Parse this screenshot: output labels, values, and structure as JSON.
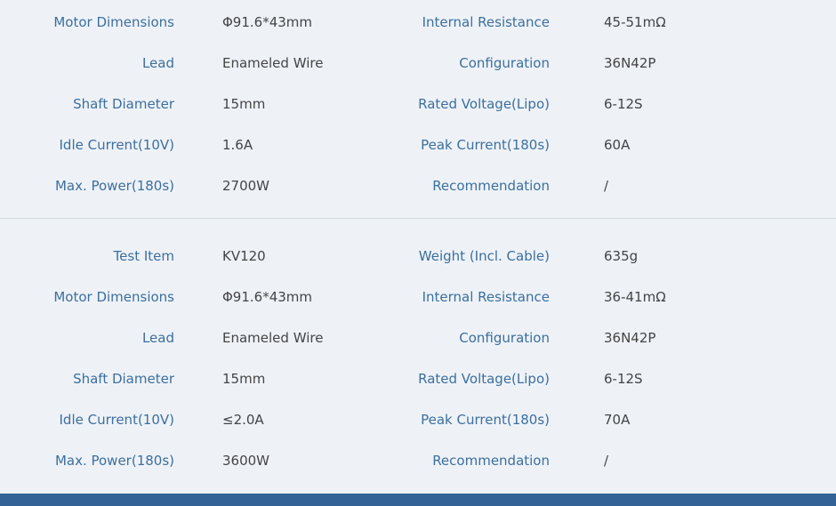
{
  "sections": [
    {
      "rows": [
        {
          "l1": "Motor Dimensions",
          "v1": "Φ91.6*43mm",
          "l2": "Internal Resistance",
          "v2": "45-51mΩ"
        },
        {
          "l1": "Lead",
          "v1": "Enameled Wire",
          "l2": "Configuration",
          "v2": "36N42P"
        },
        {
          "l1": "Shaft Diameter",
          "v1": "15mm",
          "l2": "Rated Voltage(Lipo)",
          "v2": "6-12S"
        },
        {
          "l1": "Idle Current(10V)",
          "v1": "1.6A",
          "l2": "Peak Current(180s)",
          "v2": "60A"
        },
        {
          "l1": "Max. Power(180s)",
          "v1": "2700W",
          "l2": "Recommendation",
          "v2": "/"
        }
      ]
    },
    {
      "rows": [
        {
          "l1": "Test Item",
          "v1": "KV120",
          "l2": "Weight (Incl. Cable)",
          "v2": "635g"
        },
        {
          "l1": "Motor Dimensions",
          "v1": "Φ91.6*43mm",
          "l2": "Internal Resistance",
          "v2": "36-41mΩ"
        },
        {
          "l1": "Lead",
          "v1": "Enameled Wire",
          "l2": "Configuration",
          "v2": "36N42P"
        },
        {
          "l1": "Shaft Diameter",
          "v1": "15mm",
          "l2": "Rated Voltage(Lipo)",
          "v2": "6-12S"
        },
        {
          "l1": "Idle Current(10V)",
          "v1": "≤2.0A",
          "l2": "Peak Current(180s)",
          "v2": "70A"
        },
        {
          "l1": "Max. Power(180s)",
          "v1": "3600W",
          "l2": "Recommendation",
          "v2": "/"
        }
      ]
    }
  ],
  "colors": {
    "label": "#3c6f9e",
    "value": "#444444",
    "background": "#eef2f7",
    "bottom_bar": "#336297"
  }
}
